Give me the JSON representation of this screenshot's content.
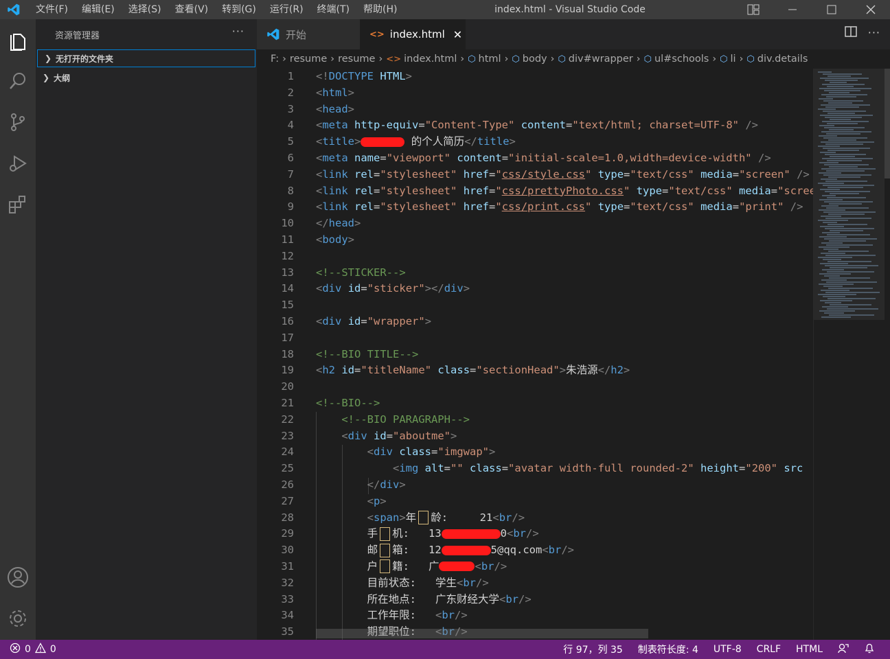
{
  "titlebar": {
    "menu": [
      "文件(F)",
      "编辑(E)",
      "选择(S)",
      "查看(V)",
      "转到(G)",
      "运行(R)",
      "终端(T)",
      "帮助(H)"
    ],
    "window_title": "index.html - Visual Studio Code"
  },
  "sidebar": {
    "title": "资源管理器",
    "more": "···",
    "sections": [
      "无打开的文件夹",
      "大纲"
    ]
  },
  "tabs": [
    {
      "label": "开始",
      "active": false
    },
    {
      "label": "index.html",
      "active": true
    }
  ],
  "breadcrumb": [
    "F:",
    "resume",
    "resume",
    "index.html",
    "html",
    "body",
    "div#wrapper",
    "ul#schools",
    "li",
    "div.details"
  ],
  "code_lines": [
    [
      [
        "t-br",
        "<!"
      ],
      [
        "t-tag",
        "DOCTYPE"
      ],
      [
        "t-txt",
        " "
      ],
      [
        "t-attr",
        "HTML"
      ],
      [
        "t-br",
        ">"
      ]
    ],
    [
      [
        "t-br",
        "<"
      ],
      [
        "t-tag",
        "html"
      ],
      [
        "t-br",
        ">"
      ]
    ],
    [
      [
        "t-br",
        "<"
      ],
      [
        "t-tag",
        "head"
      ],
      [
        "t-br",
        ">"
      ]
    ],
    [
      [
        "t-br",
        "<"
      ],
      [
        "t-tag",
        "meta"
      ],
      [
        "t-txt",
        " "
      ],
      [
        "t-attr",
        "http-equiv"
      ],
      [
        "t-txt",
        "="
      ],
      [
        "t-str",
        "\"Content-Type\""
      ],
      [
        "t-txt",
        " "
      ],
      [
        "t-attr",
        "content"
      ],
      [
        "t-txt",
        "="
      ],
      [
        "t-str",
        "\"text/html; charset=UTF-8\""
      ],
      [
        "t-txt",
        " "
      ],
      [
        "t-br",
        "/>"
      ]
    ],
    [
      [
        "t-br",
        "<"
      ],
      [
        "t-tag",
        "title"
      ],
      [
        "t-br",
        ">"
      ],
      [
        "redact",
        "64"
      ],
      [
        "t-txt",
        " 的个人简历"
      ],
      [
        "t-br",
        "</"
      ],
      [
        "t-tag",
        "title"
      ],
      [
        "t-br",
        ">"
      ]
    ],
    [
      [
        "t-br",
        "<"
      ],
      [
        "t-tag",
        "meta"
      ],
      [
        "t-txt",
        " "
      ],
      [
        "t-attr",
        "name"
      ],
      [
        "t-txt",
        "="
      ],
      [
        "t-str",
        "\"viewport\""
      ],
      [
        "t-txt",
        " "
      ],
      [
        "t-attr",
        "content"
      ],
      [
        "t-txt",
        "="
      ],
      [
        "t-str",
        "\"initial-scale=1.0,width=device-width\""
      ],
      [
        "t-txt",
        " "
      ],
      [
        "t-br",
        "/>"
      ]
    ],
    [
      [
        "t-br",
        "<"
      ],
      [
        "t-tag",
        "link"
      ],
      [
        "t-txt",
        " "
      ],
      [
        "t-attr",
        "rel"
      ],
      [
        "t-txt",
        "="
      ],
      [
        "t-str",
        "\"stylesheet\""
      ],
      [
        "t-txt",
        " "
      ],
      [
        "t-attr",
        "href"
      ],
      [
        "t-txt",
        "="
      ],
      [
        "t-str",
        "\""
      ],
      [
        "t-link",
        "css/style.css"
      ],
      [
        "t-str",
        "\""
      ],
      [
        "t-txt",
        " "
      ],
      [
        "t-attr",
        "type"
      ],
      [
        "t-txt",
        "="
      ],
      [
        "t-str",
        "\"text/css\""
      ],
      [
        "t-txt",
        " "
      ],
      [
        "t-attr",
        "media"
      ],
      [
        "t-txt",
        "="
      ],
      [
        "t-str",
        "\"screen\""
      ],
      [
        "t-txt",
        " "
      ],
      [
        "t-br",
        "/>"
      ]
    ],
    [
      [
        "t-br",
        "<"
      ],
      [
        "t-tag",
        "link"
      ],
      [
        "t-txt",
        " "
      ],
      [
        "t-attr",
        "rel"
      ],
      [
        "t-txt",
        "="
      ],
      [
        "t-str",
        "\"stylesheet\""
      ],
      [
        "t-txt",
        " "
      ],
      [
        "t-attr",
        "href"
      ],
      [
        "t-txt",
        "="
      ],
      [
        "t-str",
        "\""
      ],
      [
        "t-link",
        "css/prettyPhoto.css"
      ],
      [
        "t-str",
        "\""
      ],
      [
        "t-txt",
        " "
      ],
      [
        "t-attr",
        "type"
      ],
      [
        "t-txt",
        "="
      ],
      [
        "t-str",
        "\"text/css\""
      ],
      [
        "t-txt",
        " "
      ],
      [
        "t-attr",
        "media"
      ],
      [
        "t-txt",
        "="
      ],
      [
        "t-str",
        "\"screen\""
      ],
      [
        "t-txt",
        " "
      ],
      [
        "t-br",
        "/>"
      ]
    ],
    [
      [
        "t-br",
        "<"
      ],
      [
        "t-tag",
        "link"
      ],
      [
        "t-txt",
        " "
      ],
      [
        "t-attr",
        "rel"
      ],
      [
        "t-txt",
        "="
      ],
      [
        "t-str",
        "\"stylesheet\""
      ],
      [
        "t-txt",
        " "
      ],
      [
        "t-attr",
        "href"
      ],
      [
        "t-txt",
        "="
      ],
      [
        "t-str",
        "\""
      ],
      [
        "t-link",
        "css/print.css"
      ],
      [
        "t-str",
        "\""
      ],
      [
        "t-txt",
        " "
      ],
      [
        "t-attr",
        "type"
      ],
      [
        "t-txt",
        "="
      ],
      [
        "t-str",
        "\"text/css\""
      ],
      [
        "t-txt",
        " "
      ],
      [
        "t-attr",
        "media"
      ],
      [
        "t-txt",
        "="
      ],
      [
        "t-str",
        "\"print\""
      ],
      [
        "t-txt",
        " "
      ],
      [
        "t-br",
        "/>"
      ]
    ],
    [
      [
        "t-br",
        "</"
      ],
      [
        "t-tag",
        "head"
      ],
      [
        "t-br",
        ">"
      ]
    ],
    [
      [
        "t-br",
        "<"
      ],
      [
        "t-tag",
        "body"
      ],
      [
        "t-br",
        ">"
      ]
    ],
    [],
    [
      [
        "t-com",
        "<!--STICKER-->"
      ]
    ],
    [
      [
        "t-br",
        "<"
      ],
      [
        "t-tag",
        "div"
      ],
      [
        "t-txt",
        " "
      ],
      [
        "t-attr",
        "id"
      ],
      [
        "t-txt",
        "="
      ],
      [
        "t-str",
        "\"sticker\""
      ],
      [
        "t-br",
        "></"
      ],
      [
        "t-tag",
        "div"
      ],
      [
        "t-br",
        ">"
      ]
    ],
    [],
    [
      [
        "t-br",
        "<"
      ],
      [
        "t-tag",
        "div"
      ],
      [
        "t-txt",
        " "
      ],
      [
        "t-attr",
        "id"
      ],
      [
        "t-txt",
        "="
      ],
      [
        "t-str",
        "\"wrapper\""
      ],
      [
        "t-br",
        ">"
      ]
    ],
    [],
    [
      [
        "t-com",
        "<!--BIO TITLE-->"
      ]
    ],
    [
      [
        "t-br",
        "<"
      ],
      [
        "t-tag",
        "h2"
      ],
      [
        "t-txt",
        " "
      ],
      [
        "t-attr",
        "id"
      ],
      [
        "t-txt",
        "="
      ],
      [
        "t-str",
        "\"titleName\""
      ],
      [
        "t-txt",
        " "
      ],
      [
        "t-attr",
        "class"
      ],
      [
        "t-txt",
        "="
      ],
      [
        "t-str",
        "\"sectionHead\""
      ],
      [
        "t-br",
        ">"
      ],
      [
        "t-txt",
        "朱浩源"
      ],
      [
        "t-br",
        "</"
      ],
      [
        "t-tag",
        "h2"
      ],
      [
        "t-br",
        ">"
      ]
    ],
    [],
    [
      [
        "t-com",
        "<!--BIO-->"
      ]
    ],
    [
      [
        "t-txt",
        "    "
      ],
      [
        "t-com",
        "<!--BIO PARAGRAPH-->"
      ]
    ],
    [
      [
        "t-txt",
        "    "
      ],
      [
        "t-br",
        "<"
      ],
      [
        "t-tag",
        "div"
      ],
      [
        "t-txt",
        " "
      ],
      [
        "t-attr",
        "id"
      ],
      [
        "t-txt",
        "="
      ],
      [
        "t-str",
        "\"aboutme\""
      ],
      [
        "t-br",
        ">"
      ]
    ],
    [
      [
        "t-txt",
        "        "
      ],
      [
        "t-br",
        "<"
      ],
      [
        "t-tag",
        "div"
      ],
      [
        "t-txt",
        " "
      ],
      [
        "t-attr",
        "class"
      ],
      [
        "t-txt",
        "="
      ],
      [
        "t-str",
        "\"imgwap\""
      ],
      [
        "t-br",
        ">"
      ]
    ],
    [
      [
        "t-txt",
        "            "
      ],
      [
        "t-br",
        "<"
      ],
      [
        "t-tag",
        "img"
      ],
      [
        "t-txt",
        " "
      ],
      [
        "t-attr",
        "alt"
      ],
      [
        "t-txt",
        "="
      ],
      [
        "t-str",
        "\"\""
      ],
      [
        "t-txt",
        " "
      ],
      [
        "t-attr",
        "class"
      ],
      [
        "t-txt",
        "="
      ],
      [
        "t-str",
        "\"avatar width-full rounded-2\""
      ],
      [
        "t-txt",
        " "
      ],
      [
        "t-attr",
        "height"
      ],
      [
        "t-txt",
        "="
      ],
      [
        "t-str",
        "\"200\""
      ],
      [
        "t-txt",
        " "
      ],
      [
        "t-attr",
        "src"
      ]
    ],
    [
      [
        "t-txt",
        "        "
      ],
      [
        "t-br",
        "</"
      ],
      [
        "t-tag",
        "div"
      ],
      [
        "t-br",
        ">"
      ]
    ],
    [
      [
        "t-txt",
        "        "
      ],
      [
        "t-br",
        "<"
      ],
      [
        "t-tag",
        "p"
      ],
      [
        "t-br",
        ">"
      ]
    ],
    [
      [
        "t-txt",
        "        "
      ],
      [
        "t-br",
        "<"
      ],
      [
        "t-tag",
        "span"
      ],
      [
        "t-br",
        ">"
      ],
      [
        "t-txt",
        "年"
      ],
      [
        "box",
        ""
      ],
      [
        "t-txt",
        "龄:     21"
      ],
      [
        "t-br",
        "<"
      ],
      [
        "t-tag",
        "br"
      ],
      [
        "t-br",
        "/>"
      ]
    ],
    [
      [
        "t-txt",
        "        手"
      ],
      [
        "box",
        ""
      ],
      [
        "t-txt",
        "机:   13"
      ],
      [
        "redact",
        "86"
      ],
      [
        "t-txt",
        "0"
      ],
      [
        "t-br",
        "<"
      ],
      [
        "t-tag",
        "br"
      ],
      [
        "t-br",
        "/>"
      ]
    ],
    [
      [
        "t-txt",
        "        邮"
      ],
      [
        "box",
        ""
      ],
      [
        "t-txt",
        "箱:   12"
      ],
      [
        "redact",
        "72"
      ],
      [
        "t-txt",
        "5@qq.com"
      ],
      [
        "t-br",
        "<"
      ],
      [
        "t-tag",
        "br"
      ],
      [
        "t-br",
        "/>"
      ]
    ],
    [
      [
        "t-txt",
        "        户"
      ],
      [
        "box",
        ""
      ],
      [
        "t-txt",
        "籍:   广"
      ],
      [
        "redact",
        "52"
      ],
      [
        "t-br",
        "<"
      ],
      [
        "t-tag",
        "br"
      ],
      [
        "t-br",
        "/>"
      ]
    ],
    [
      [
        "t-txt",
        "        目前状态:   学生"
      ],
      [
        "t-br",
        "<"
      ],
      [
        "t-tag",
        "br"
      ],
      [
        "t-br",
        "/>"
      ]
    ],
    [
      [
        "t-txt",
        "        所在地点:   广东财经大学"
      ],
      [
        "t-br",
        "<"
      ],
      [
        "t-tag",
        "br"
      ],
      [
        "t-br",
        "/>"
      ]
    ],
    [
      [
        "t-txt",
        "        工作年限:   "
      ],
      [
        "t-br",
        "<"
      ],
      [
        "t-tag",
        "br"
      ],
      [
        "t-br",
        "/>"
      ]
    ],
    [
      [
        "t-txt",
        "        期望职位:   "
      ],
      [
        "t-br",
        "<"
      ],
      [
        "t-tag",
        "br"
      ],
      [
        "t-br",
        "/>"
      ]
    ]
  ],
  "statusbar": {
    "errors": "0",
    "warnings": "0",
    "position": "行 97，列 35",
    "tab_size": "制表符长度: 4",
    "encoding": "UTF-8",
    "eol": "CRLF",
    "language": "HTML"
  },
  "colors": {
    "statusbar": "#68217a",
    "accent": "#007fd4",
    "tag": "#569cd6",
    "attribute": "#9cdcfe",
    "string": "#ce9178",
    "comment": "#6a9955"
  }
}
